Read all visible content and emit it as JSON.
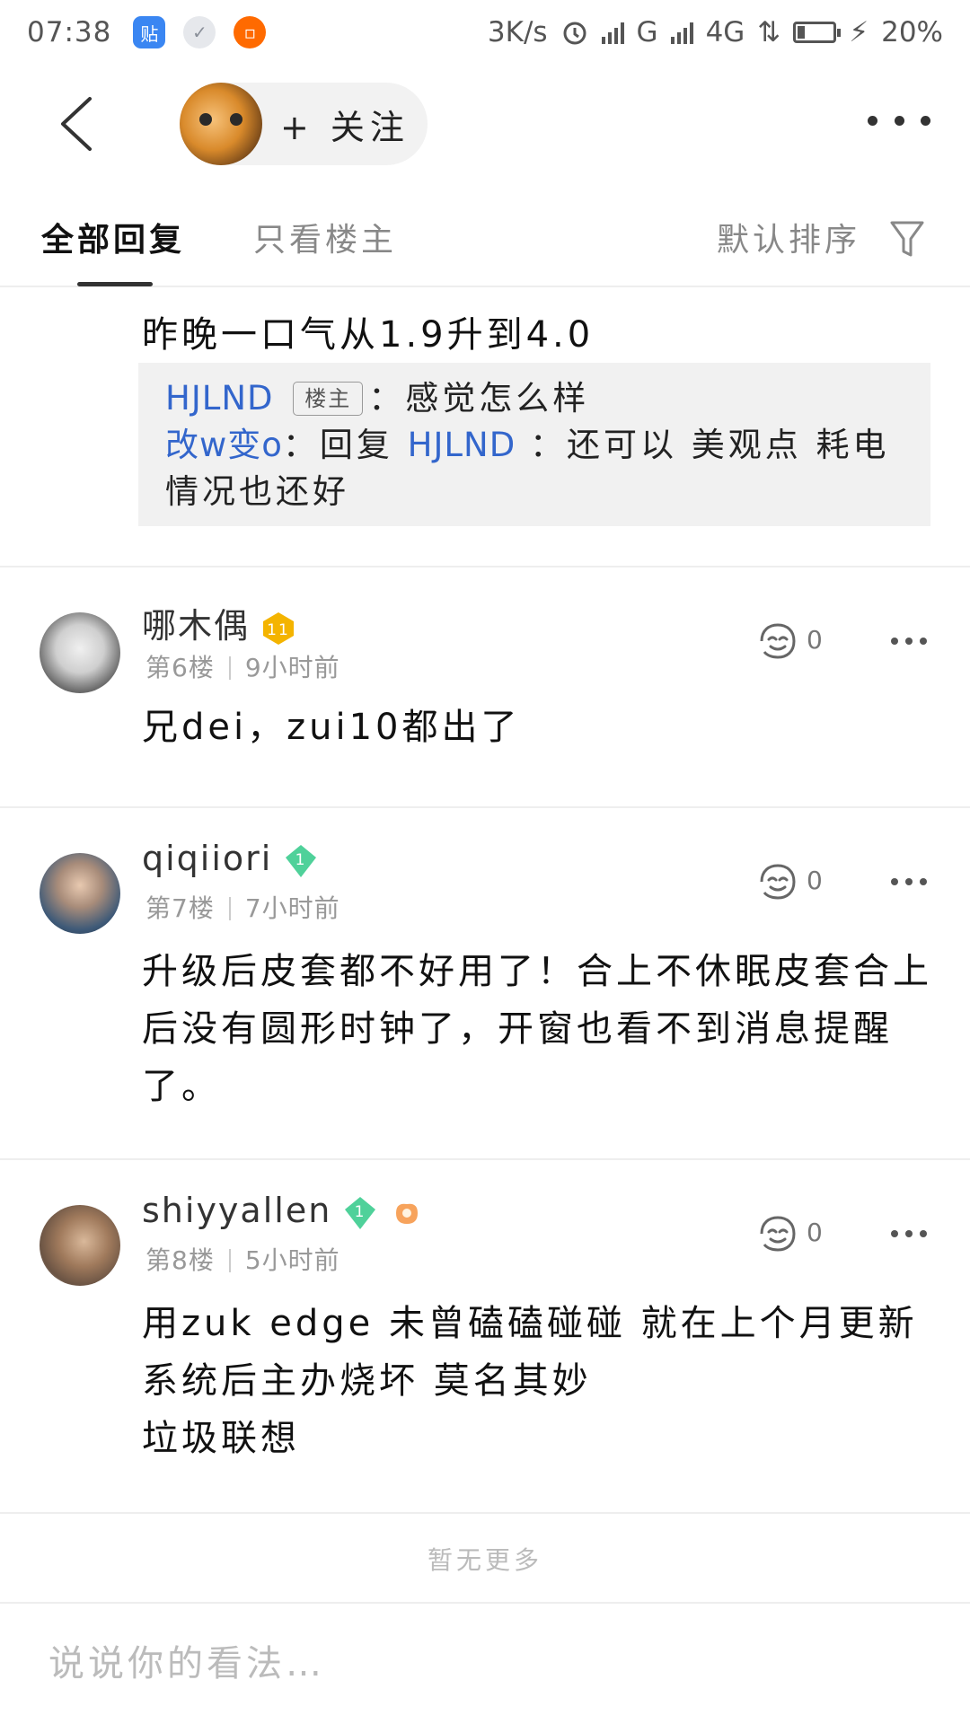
{
  "status_bar": {
    "time": "07:38",
    "app_icon_tieba": "贴",
    "net_speed": "3K/s",
    "net_g": "G",
    "net_4g": "4G",
    "battery_percent": "20%",
    "battery_level": 0.2
  },
  "nav": {
    "follow_label": "+ 关注"
  },
  "tabs": {
    "all_replies": "全部回复",
    "only_owner": "只看楼主",
    "sort_label": "默认排序"
  },
  "top_reply": {
    "text": "昨晚一口气从1.9升到4.0",
    "sub_replies": [
      {
        "user": "HJLND",
        "badge": "楼主",
        "text": "：感觉怎么样"
      },
      {
        "user": "改w变o",
        "prefix": "：回复 ",
        "reply_to": "HJLND",
        "text": " ：还可以 美观点 耗电情况也还好"
      }
    ]
  },
  "posts": [
    {
      "username": "哪木偶",
      "level": "11",
      "level_color": "#f4b400",
      "floor": "第6楼",
      "time": "9小时前",
      "agree_count": "0",
      "content": "兄dei，zui10都出了"
    },
    {
      "username": "qiqiiori",
      "level": "1",
      "level_color": "#4fd19a",
      "floor": "第7楼",
      "time": "7小时前",
      "agree_count": "0",
      "content": "升级后皮套都不好用了！合上不休眠皮套合上后没有圆形时钟了，开窗也看不到消息提醒了。"
    },
    {
      "username": "shiyyallen",
      "level": "1",
      "level_color": "#4fd19a",
      "floor": "第8楼",
      "time": "5小时前",
      "agree_count": "0",
      "content_lines": [
        "用zuk edge 未曾磕磕碰碰 就在上个月更新系统后主办烧坏 莫名其妙",
        "垃圾联想"
      ]
    }
  ],
  "footer": {
    "no_more": "暂无更多",
    "comment_placeholder": "说说你的看法…"
  },
  "colors": {
    "link_blue": "#3366cc",
    "level_gold": "#f4b400",
    "level_green": "#4fd19a"
  }
}
